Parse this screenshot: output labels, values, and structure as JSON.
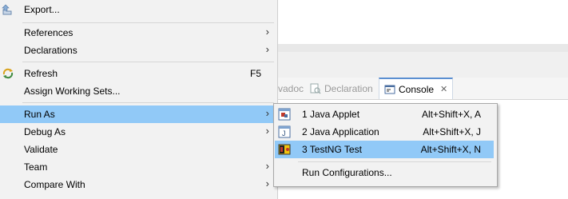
{
  "context_menu": {
    "items": [
      {
        "label": "Export...",
        "icon": "export-icon"
      },
      {
        "label": "References",
        "submenu": true
      },
      {
        "label": "Declarations",
        "submenu": true
      },
      {
        "label": "Refresh",
        "shortcut": "F5",
        "icon": "refresh-icon"
      },
      {
        "label": "Assign Working Sets..."
      },
      {
        "label": "Run As",
        "submenu": true,
        "selected": true
      },
      {
        "label": "Debug As",
        "submenu": true
      },
      {
        "label": "Validate"
      },
      {
        "label": "Team",
        "submenu": true
      },
      {
        "label": "Compare With",
        "submenu": true
      }
    ],
    "submenu_arrow": "›"
  },
  "run_as_submenu": {
    "items": [
      {
        "label": "1 Java Applet",
        "shortcut": "Alt+Shift+X, A",
        "icon": "java-applet-icon"
      },
      {
        "label": "2 Java Application",
        "shortcut": "Alt+Shift+X, J",
        "icon": "java-application-icon"
      },
      {
        "label": "3 TestNG Test",
        "shortcut": "Alt+Shift+X, N",
        "icon": "testng-icon",
        "selected": true
      },
      {
        "label": "Run Configurations..."
      }
    ]
  },
  "view_tabs": [
    {
      "label": "vadoc"
    },
    {
      "label": "Declaration",
      "icon": "declaration-icon"
    },
    {
      "label": "Console",
      "icon": "console-icon",
      "active": true,
      "close": "✕"
    }
  ],
  "colors": {
    "menu_bg": "#f2f2f2",
    "selection": "#91c9f7",
    "tab_active_border": "#5b8fd1"
  }
}
